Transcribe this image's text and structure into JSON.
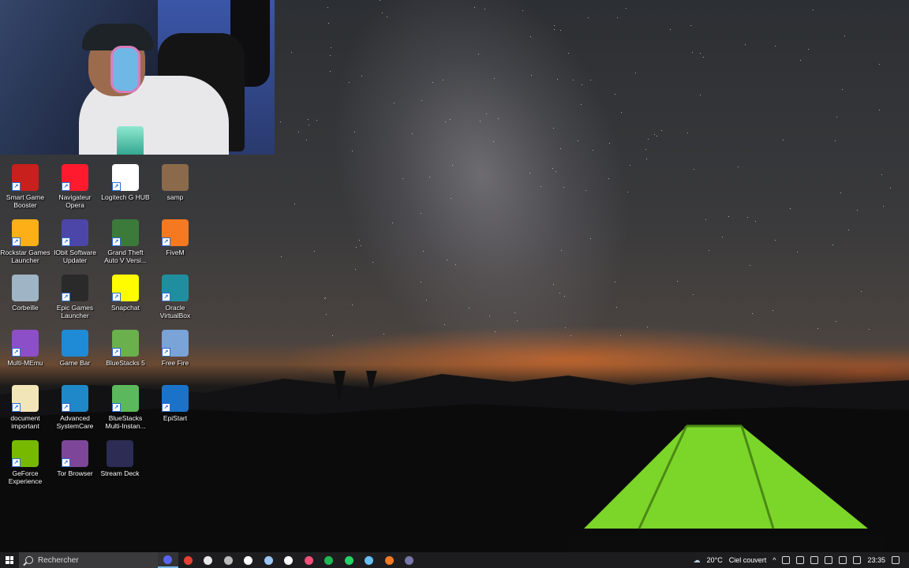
{
  "desktop": {
    "icons": [
      {
        "label": "Smart Game Booster",
        "icon": "smart-game-booster-icon",
        "color": "#c8201c"
      },
      {
        "label": "Navigateur Opera",
        "icon": "opera-icon",
        "color": "#ff1b2d"
      },
      {
        "label": "Logitech G HUB",
        "icon": "logitech-g-hub-icon",
        "color": "#ffffff"
      },
      {
        "label": "samp",
        "icon": "samp-icon",
        "color": "#8a6a4a"
      },
      {
        "label": "Rockstar Games Launcher",
        "icon": "rockstar-icon",
        "color": "#fcaf17"
      },
      {
        "label": "IObit Software Updater",
        "icon": "iobit-updater-icon",
        "color": "#4c46a8"
      },
      {
        "label": "Grand Theft Auto V Versi...",
        "icon": "gta-v-icon",
        "color": "#3c7a3c"
      },
      {
        "label": "FiveM",
        "icon": "fivem-icon",
        "color": "#f47920"
      },
      {
        "label": "Corbeille",
        "icon": "recycle-bin-icon",
        "color": "#9fb4c4"
      },
      {
        "label": "Epic Games Launcher",
        "icon": "epic-games-icon",
        "color": "#2a2a2a"
      },
      {
        "label": "Snapchat",
        "icon": "snapchat-icon",
        "color": "#fffc00"
      },
      {
        "label": "Oracle VirtualBox",
        "icon": "virtualbox-icon",
        "color": "#1f8fa0"
      },
      {
        "label": "Multi-MEmu",
        "icon": "multi-memu-icon",
        "color": "#8d4fc7"
      },
      {
        "label": "Game Bar",
        "icon": "game-bar-icon",
        "color": "#1f8ad6"
      },
      {
        "label": "BlueStacks 5",
        "icon": "bluestacks-icon",
        "color": "#6ab04c"
      },
      {
        "label": "Free Fire",
        "icon": "free-fire-icon",
        "color": "#7aa3d8"
      },
      {
        "label": "document important",
        "icon": "document-icon",
        "color": "#f2e5b8"
      },
      {
        "label": "Advanced SystemCare",
        "icon": "advanced-systemcare-icon",
        "color": "#1e88c8"
      },
      {
        "label": "BlueStacks Multi-Instan...",
        "icon": "bluestacks-multi-icon",
        "color": "#5cb85c"
      },
      {
        "label": "EpiStart",
        "icon": "epistart-icon",
        "color": "#1a73c8"
      },
      {
        "label": "GeForce Experience",
        "icon": "geforce-icon",
        "color": "#76b900"
      },
      {
        "label": "Tor Browser",
        "icon": "tor-browser-icon",
        "color": "#7d4698"
      },
      {
        "label": "Stream Deck",
        "icon": "stream-deck-icon",
        "color": "#2c2c54"
      }
    ]
  },
  "taskbar": {
    "search_placeholder": "Rechercher",
    "apps": [
      {
        "name": "discord-app",
        "color": "#5865f2",
        "active": true
      },
      {
        "name": "chrome-app",
        "color": "#e44134",
        "active": false
      },
      {
        "name": "file-explorer-app",
        "color": "#e8e8e8",
        "active": false
      },
      {
        "name": "settings-app",
        "color": "#bbbbbb",
        "active": false
      },
      {
        "name": "tiktok-app",
        "color": "#ffffff",
        "active": false
      },
      {
        "name": "photos-app",
        "color": "#9bc7f5",
        "active": false
      },
      {
        "name": "capcut-app",
        "color": "#ffffff",
        "active": false
      },
      {
        "name": "music-app",
        "color": "#f54f7a",
        "active": false
      },
      {
        "name": "spotify-app",
        "color": "#1db954",
        "active": false
      },
      {
        "name": "whatsapp-app",
        "color": "#25d366",
        "active": false
      },
      {
        "name": "steam-app",
        "color": "#66c0f4",
        "active": false
      },
      {
        "name": "fivem-app",
        "color": "#f47920",
        "active": false
      },
      {
        "name": "stream-deck-app",
        "color": "#7777aa",
        "active": false
      }
    ],
    "weather_temp": "20°C",
    "weather_desc": "Ciel couvert",
    "time": "23:35"
  }
}
